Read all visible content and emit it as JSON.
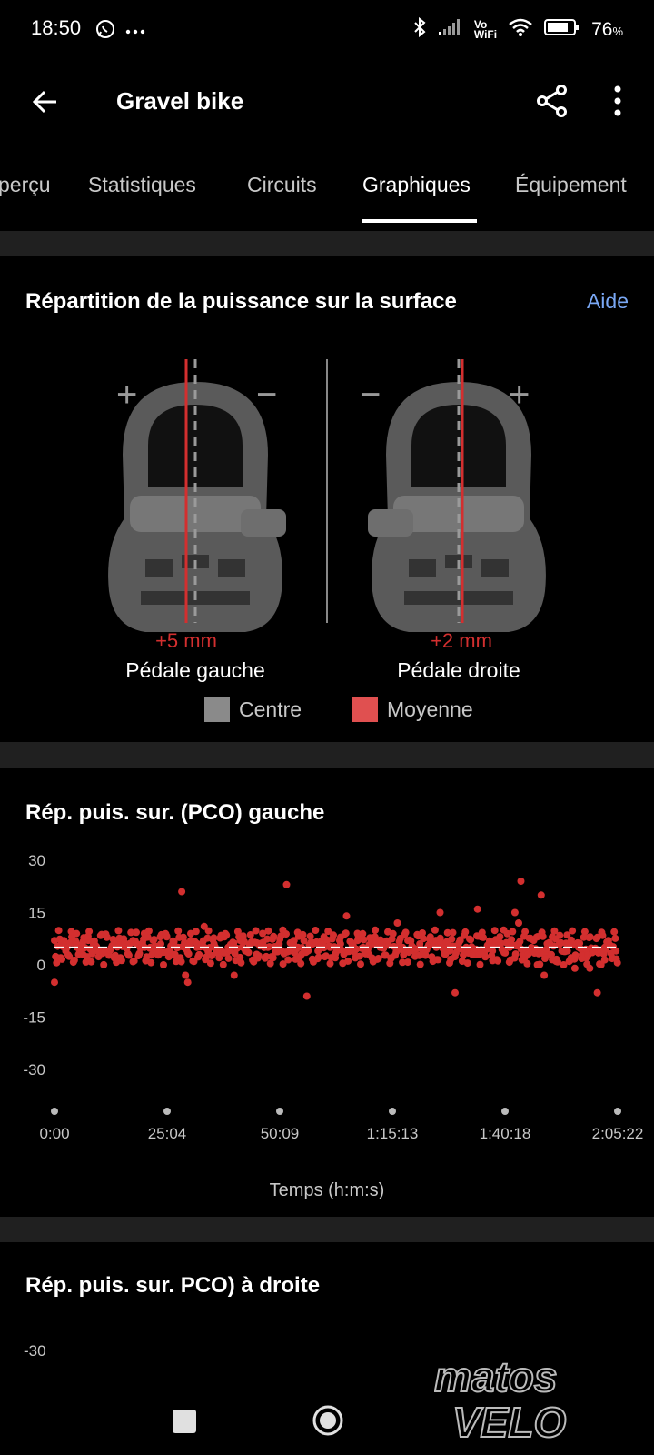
{
  "status_bar": {
    "time": "18:50",
    "left_icons": [
      "whatsapp-icon",
      "more-dots-icon"
    ],
    "right_icons": [
      "bluetooth-icon",
      "signal-icon",
      "vowifi-icon",
      "wifi-icon",
      "battery-icon"
    ],
    "vowifi_label_top": "Vo",
    "vowifi_label_bottom": "WiFi",
    "battery_percent": "76",
    "battery_unit": "%"
  },
  "app_bar": {
    "title": "Gravel bike",
    "icons": [
      "back-arrow-icon",
      "share-icon",
      "more-vert-icon"
    ]
  },
  "tabs": [
    {
      "label": "perçu",
      "active": false
    },
    {
      "label": "Statistiques",
      "active": false
    },
    {
      "label": "Circuits",
      "active": false
    },
    {
      "label": "Graphiques",
      "active": true
    },
    {
      "label": "Équipement",
      "active": false
    }
  ],
  "power_distribution": {
    "title": "Répartition de la puissance sur la surface",
    "help_label": "Aide",
    "left_pedal": {
      "name": "Pédale gauche",
      "offset": "+5 mm",
      "plus_sign": "+",
      "minus_sign": "−"
    },
    "right_pedal": {
      "name": "Pédale droite",
      "offset": "+2 mm",
      "plus_sign": "+",
      "minus_sign": "−"
    },
    "legend": [
      {
        "label": "Centre",
        "color": "#8a8a8a"
      },
      {
        "label": "Moyenne",
        "color": "#e05050"
      }
    ]
  },
  "left_chart_section": {
    "title": "Rép. puis. sur. (PCO) gauche"
  },
  "chart_data": {
    "type": "scatter",
    "title": "Rép. puis. sur. (PCO) gauche",
    "xlabel": "Temps (h:m:s)",
    "ylabel": "",
    "x_tick_labels": [
      "0:00",
      "25:04",
      "50:09",
      "1:15:13",
      "1:40:18",
      "2:05:22"
    ],
    "x_range_seconds": [
      0,
      7522
    ],
    "y_tick_labels": [
      "30",
      "15",
      "0",
      "-15",
      "-30"
    ],
    "ylim": [
      -30,
      30
    ],
    "average_line": 5,
    "series": [
      {
        "color": "#d32f2f",
        "points": [
          [
            0,
            -5
          ],
          [
            40,
            2
          ],
          [
            90,
            6
          ],
          [
            150,
            4
          ],
          [
            230,
            8
          ],
          [
            300,
            5
          ],
          [
            380,
            3
          ],
          [
            450,
            7
          ],
          [
            520,
            6
          ],
          [
            600,
            4
          ],
          [
            700,
            8
          ],
          [
            800,
            2
          ],
          [
            880,
            6
          ],
          [
            960,
            5
          ],
          [
            1050,
            7
          ],
          [
            1130,
            3
          ],
          [
            1200,
            9
          ],
          [
            1280,
            5
          ],
          [
            1350,
            4
          ],
          [
            1420,
            6
          ],
          [
            1500,
            8
          ],
          [
            1580,
            3
          ],
          [
            1650,
            5
          ],
          [
            1700,
            21
          ],
          [
            1750,
            -3
          ],
          [
            1780,
            -5
          ],
          [
            1820,
            7
          ],
          [
            1900,
            5
          ],
          [
            2000,
            11
          ],
          [
            2050,
            4
          ],
          [
            2130,
            6
          ],
          [
            2200,
            2
          ],
          [
            2270,
            8
          ],
          [
            2320,
            5
          ],
          [
            2400,
            -3
          ],
          [
            2480,
            7
          ],
          [
            2550,
            4
          ],
          [
            2620,
            6
          ],
          [
            2700,
            3
          ],
          [
            2780,
            9
          ],
          [
            2850,
            5
          ],
          [
            2920,
            2
          ],
          [
            3000,
            6
          ],
          [
            3050,
            10
          ],
          [
            3100,
            23
          ],
          [
            3150,
            4
          ],
          [
            3200,
            7
          ],
          [
            3250,
            5
          ],
          [
            3300,
            3
          ],
          [
            3370,
            -9
          ],
          [
            3450,
            6
          ],
          [
            3520,
            4
          ],
          [
            3600,
            8
          ],
          [
            3680,
            5
          ],
          [
            3750,
            2
          ],
          [
            3820,
            6
          ],
          [
            3900,
            14
          ],
          [
            3980,
            4
          ],
          [
            4050,
            7
          ],
          [
            4120,
            5
          ],
          [
            4200,
            3
          ],
          [
            4280,
            8
          ],
          [
            4350,
            5
          ],
          [
            4420,
            6
          ],
          [
            4500,
            2
          ],
          [
            4580,
            12
          ],
          [
            4650,
            5
          ],
          [
            4720,
            7
          ],
          [
            4800,
            4
          ],
          [
            4880,
            6
          ],
          [
            4950,
            3
          ],
          [
            5020,
            8
          ],
          [
            5100,
            5
          ],
          [
            5150,
            15
          ],
          [
            5200,
            6
          ],
          [
            5280,
            4
          ],
          [
            5350,
            -8
          ],
          [
            5420,
            7
          ],
          [
            5500,
            5
          ],
          [
            5580,
            3
          ],
          [
            5650,
            16
          ],
          [
            5700,
            8
          ],
          [
            5780,
            5
          ],
          [
            5850,
            4
          ],
          [
            5920,
            6
          ],
          [
            6000,
            10
          ],
          [
            6080,
            5
          ],
          [
            6150,
            15
          ],
          [
            6200,
            12
          ],
          [
            6230,
            24
          ],
          [
            6280,
            2
          ],
          [
            6320,
            4
          ],
          [
            6400,
            7
          ],
          [
            6450,
            0
          ],
          [
            6500,
            20
          ],
          [
            6540,
            -3
          ],
          [
            6600,
            3
          ],
          [
            6650,
            8
          ],
          [
            6700,
            1
          ],
          [
            6750,
            6
          ],
          [
            6800,
            0
          ],
          [
            6850,
            4
          ],
          [
            6900,
            2
          ],
          [
            6950,
            -1
          ],
          [
            7000,
            5
          ],
          [
            7050,
            3
          ],
          [
            7100,
            2
          ],
          [
            7150,
            -1
          ],
          [
            7200,
            4
          ],
          [
            7250,
            -8
          ],
          [
            7300,
            0
          ],
          [
            7350,
            5
          ],
          [
            7400,
            7
          ],
          [
            7450,
            2
          ],
          [
            7500,
            4
          ]
        ]
      }
    ]
  },
  "right_chart_section": {
    "title": "Rép. puis. sur. PCO) à droite",
    "first_tick": "-30"
  },
  "nav_bar": {
    "icons": [
      "recents-icon",
      "home-icon"
    ]
  },
  "watermark": {
    "text_top": "matos",
    "text_bottom": "VELO"
  }
}
